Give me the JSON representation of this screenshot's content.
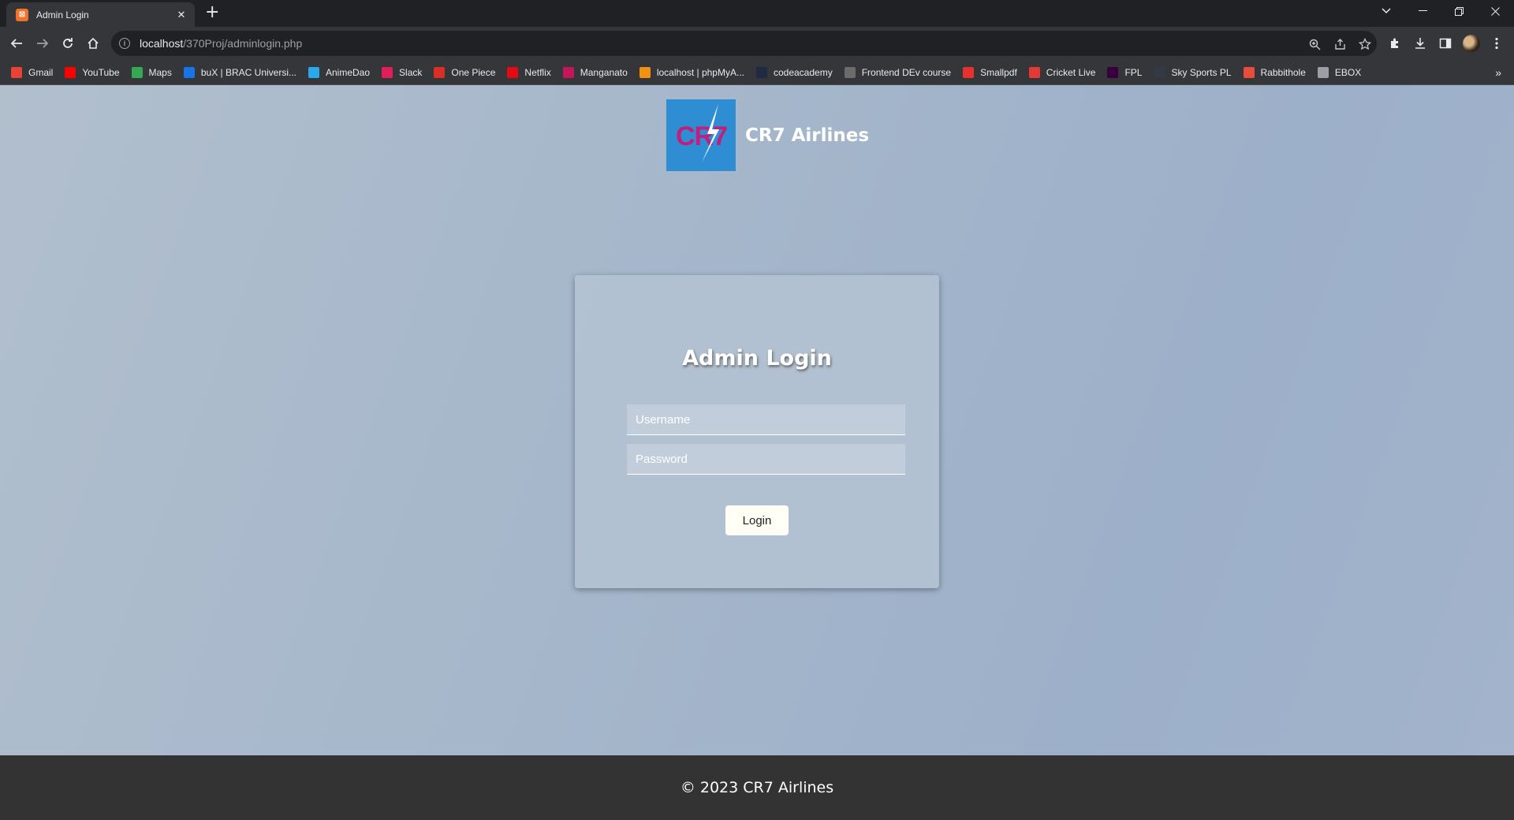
{
  "browser": {
    "tab_title": "Admin Login",
    "tab_close": "✕",
    "new_tab": "+",
    "url_host": "localhost",
    "url_path": "/370Proj/adminlogin.php"
  },
  "bookmarks": [
    {
      "label": "Gmail",
      "color": "#ea4335"
    },
    {
      "label": "YouTube",
      "color": "#ff0000"
    },
    {
      "label": "Maps",
      "color": "#34a853"
    },
    {
      "label": "buX | BRAC Universi...",
      "color": "#1a73e8"
    },
    {
      "label": "AnimeDao",
      "color": "#29a9eb"
    },
    {
      "label": "Slack",
      "color": "#e01e5a"
    },
    {
      "label": "One Piece",
      "color": "#d93025"
    },
    {
      "label": "Netflix",
      "color": "#e50914"
    },
    {
      "label": "Manganato",
      "color": "#c2185b"
    },
    {
      "label": "localhost | phpMyA...",
      "color": "#f29111"
    },
    {
      "label": "codeacademy",
      "color": "#1f2a44"
    },
    {
      "label": "Frontend DEv course",
      "color": "#6b6b6b"
    },
    {
      "label": "Smallpdf",
      "color": "#e5322d"
    },
    {
      "label": "Cricket Live",
      "color": "#e53935"
    },
    {
      "label": "FPL",
      "color": "#37003c"
    },
    {
      "label": "Sky Sports PL",
      "color": "#333a44"
    },
    {
      "label": "Rabbithole",
      "color": "#e84c3d"
    },
    {
      "label": "EBOX",
      "color": "#9aa0a6"
    }
  ],
  "brand": {
    "logo_text": "CR7",
    "name": "CR7 Airlines"
  },
  "login": {
    "title": "Admin Login",
    "username_placeholder": "Username",
    "password_placeholder": "Password",
    "button_label": "Login"
  },
  "footer": {
    "text": "© 2023 CR7 Airlines"
  }
}
